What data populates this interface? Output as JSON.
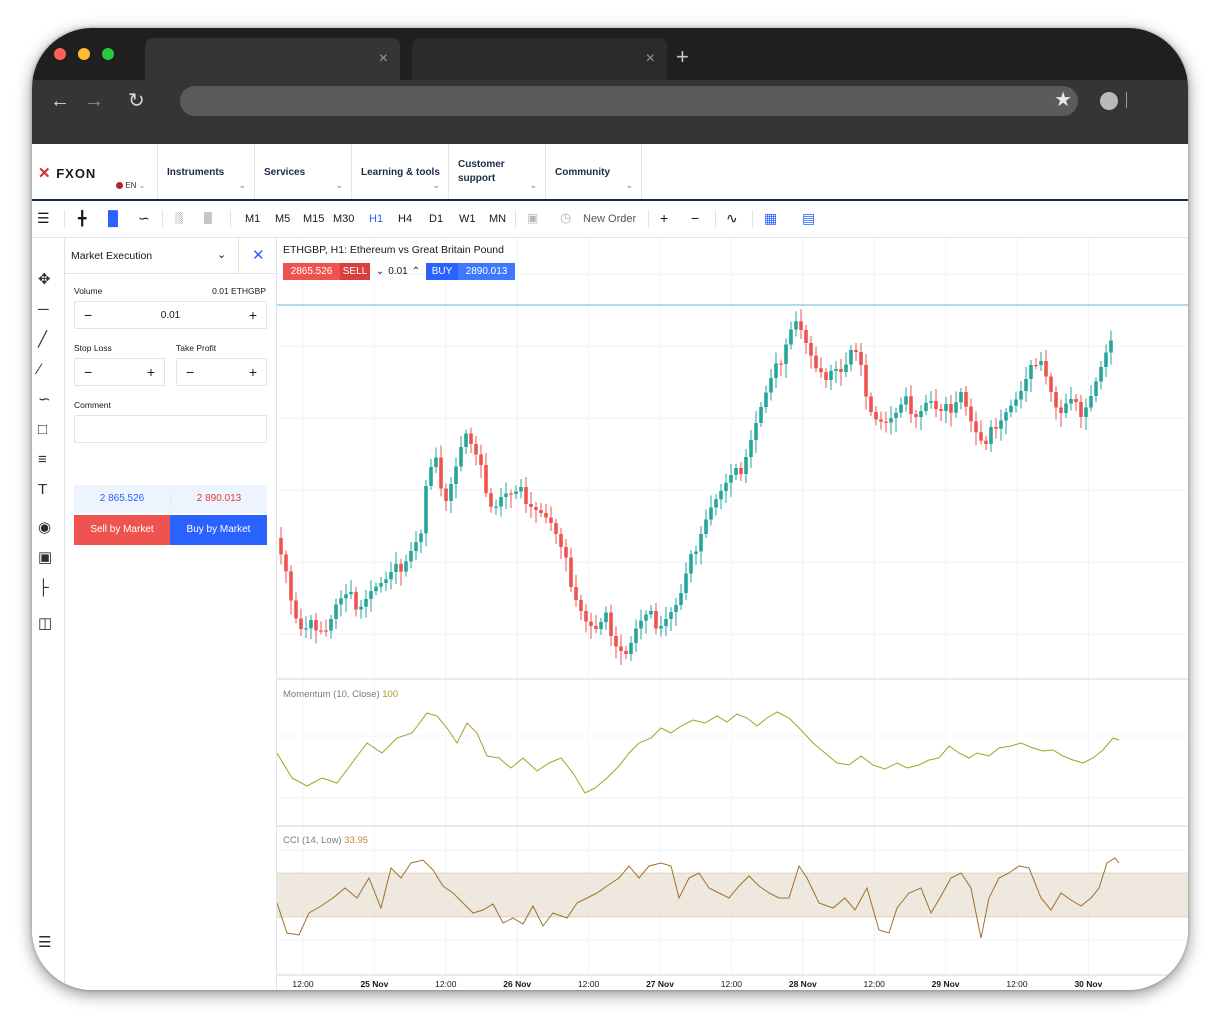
{
  "browser": {
    "new_tab_symbol": "+",
    "tab_close_symbol": "×"
  },
  "site": {
    "logo_text": "FXON",
    "language": "EN",
    "menu": [
      {
        "label": "Instruments"
      },
      {
        "label": "Services"
      },
      {
        "label": "Learning & tools"
      },
      {
        "label": "Customer support"
      },
      {
        "label": "Community"
      }
    ]
  },
  "toolbar": {
    "timeframes": [
      "M1",
      "M5",
      "M15",
      "M30",
      "H1",
      "H4",
      "D1",
      "W1",
      "MN"
    ],
    "active_timeframe": "H1",
    "new_order_label": "New Order",
    "zoom_in": "+",
    "zoom_out": "−"
  },
  "order_panel": {
    "title": "Market Execution",
    "volume_label": "Volume",
    "volume_info": "0.01 ETHGBP",
    "volume_value": "0.01",
    "stop_loss_label": "Stop Loss",
    "take_profit_label": "Take Profit",
    "comment_label": "Comment",
    "bid": "2 865.526",
    "ask": "2 890.013",
    "sell_label": "Sell by Market",
    "buy_label": "Buy by Market"
  },
  "chart": {
    "title": "ETHGBP, H1: Ethereum vs Great Britain Pound",
    "sell_price": "2865.526",
    "sell_label": "SELL",
    "lot": "0.01",
    "buy_label": "BUY",
    "buy_price": "2890.013",
    "momentum_label": "Momentum (10, Close)",
    "momentum_value": "100",
    "cci_label": "CCI (14, Low)",
    "cci_value": "33.95",
    "x_labels": [
      "12:00",
      "25 Nov",
      "12:00",
      "26 Nov",
      "12:00",
      "27 Nov",
      "12:00",
      "28 Nov",
      "12:00",
      "29 Nov",
      "12:00",
      "30 Nov"
    ]
  },
  "colors": {
    "up": "#26a69a",
    "down": "#ef5350",
    "accent": "#2962ff",
    "momentum_line": "#a8a020",
    "cci_line": "#a0702a",
    "cci_band": "#e8e0d4"
  }
}
